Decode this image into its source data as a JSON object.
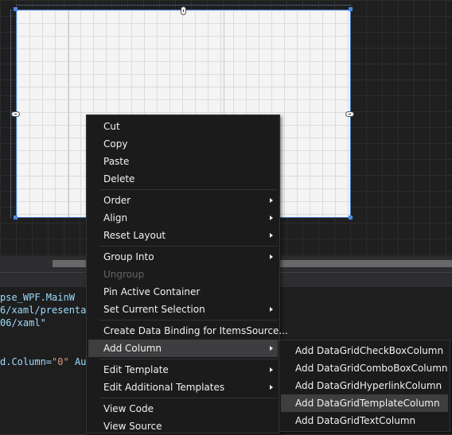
{
  "code": {
    "line1": "pse_WPF.MainW",
    "line2": "6/xaml/presentat",
    "line3": "06/xaml\"",
    "line4_attr": "d.Column=",
    "line4_val": "\"0\"",
    "line4_tail": " Au"
  },
  "context_menu": {
    "items": [
      {
        "label": "Cut"
      },
      {
        "label": "Copy"
      },
      {
        "label": "Paste"
      },
      {
        "label": "Delete"
      },
      {
        "label": "Order"
      },
      {
        "label": "Align"
      },
      {
        "label": "Reset Layout"
      },
      {
        "label": "Group Into"
      },
      {
        "label": "Ungroup"
      },
      {
        "label": "Pin Active Container"
      },
      {
        "label": "Set Current Selection"
      },
      {
        "label": "Create Data Binding for ItemsSource..."
      },
      {
        "label": "Add Column"
      },
      {
        "label": "Edit Template"
      },
      {
        "label": "Edit Additional Templates"
      },
      {
        "label": "View Code"
      },
      {
        "label": "View Source"
      }
    ]
  },
  "submenu": {
    "items": [
      {
        "label": "Add DataGridCheckBoxColumn"
      },
      {
        "label": "Add DataGridComboBoxColumn"
      },
      {
        "label": "Add DataGridHyperlinkColumn"
      },
      {
        "label": "Add DataGridTemplateColumn"
      },
      {
        "label": "Add DataGridTextColumn"
      }
    ]
  }
}
